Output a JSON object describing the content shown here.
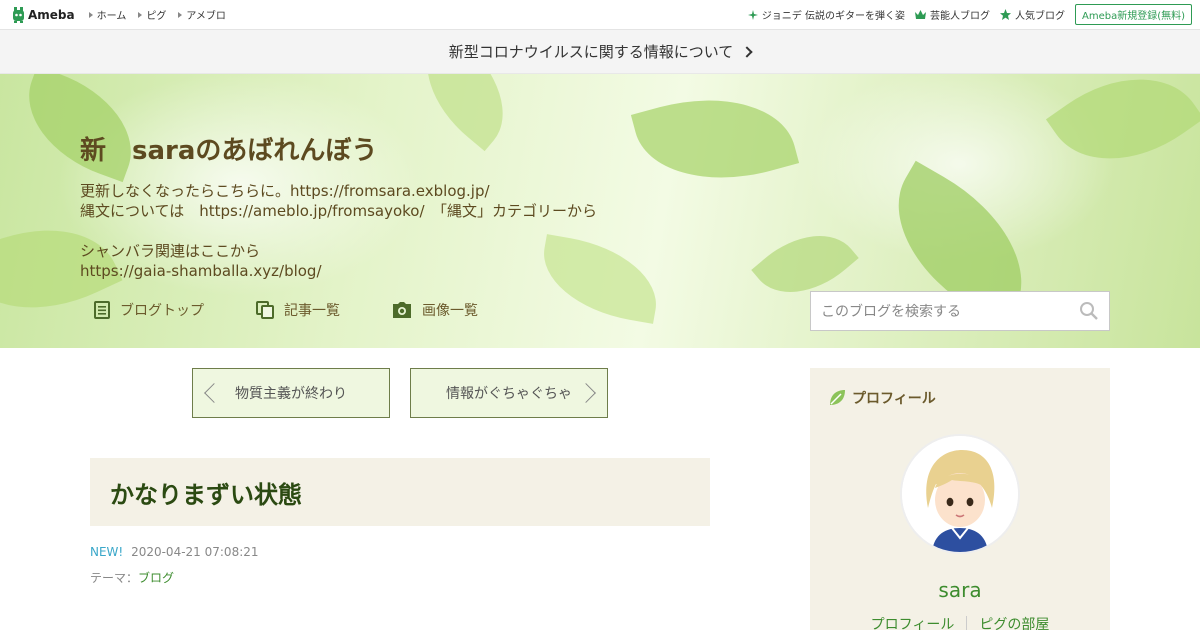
{
  "topbar": {
    "logo_text": "Ameba",
    "nav": [
      "ホーム",
      "ピグ",
      "アメブロ"
    ],
    "right_links": [
      {
        "icon": "sparkle-icon",
        "label": "ジョニデ 伝説のギターを弾く姿"
      },
      {
        "icon": "crown-icon",
        "label": "芸能人ブログ"
      },
      {
        "icon": "star-icon",
        "label": "人気ブログ"
      }
    ],
    "register_label": "Ameba新規登録(無料)"
  },
  "notice": {
    "text": "新型コロナウイルスに関する情報について"
  },
  "header": {
    "title": "新　saraのあばれんぼう",
    "description_lines": [
      "更新しなくなったらこちらに。https://fromsara.exblog.jp/",
      "縄文については　https://ameblo.jp/fromsayoko/　「縄文」カテゴリーから",
      "",
      "シャンバラ関連はここから",
      "https://gaia-shamballa.xyz/blog/"
    ],
    "nav": [
      {
        "icon": "document-icon",
        "label": "ブログトップ"
      },
      {
        "icon": "copy-icon",
        "label": "記事一覧"
      },
      {
        "icon": "camera-icon",
        "label": "画像一覧"
      }
    ],
    "search_placeholder": "このブログを検索する"
  },
  "pager": {
    "prev_label": "物質主義が終わり",
    "next_label": "情報がぐちゃぐちゃ"
  },
  "entry": {
    "title": "かなりまずい状態",
    "new_badge": "NEW!",
    "datetime": "2020-04-21 07:08:21",
    "theme_prefix": "テーマ：",
    "theme": "ブログ"
  },
  "sidebar": {
    "heading": "プロフィール",
    "name": "sara",
    "links": [
      "プロフィール",
      "ピグの部屋"
    ]
  },
  "colors": {
    "brand_green": "#2e9b54",
    "title_brown": "#5d4a20",
    "entry_title_green": "#2b4a12",
    "link_green": "#3d8c2e",
    "new_blue": "#3aa7c9"
  }
}
